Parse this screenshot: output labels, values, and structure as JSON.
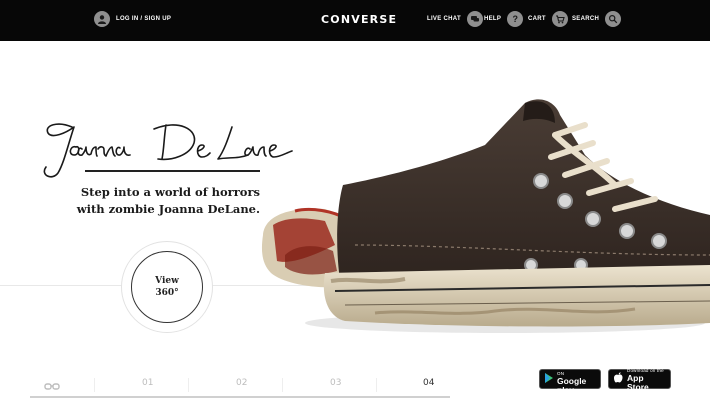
{
  "header": {
    "login_label": "LOG IN / SIGN UP",
    "logo_text": "CONVERSE",
    "live_chat_label": "LIVE CHAT",
    "help_label": "HELP",
    "cart_label": "CART",
    "search_label": "SEARCH",
    "icons": [
      "user-icon",
      "chat-icon",
      "help-icon",
      "cart-icon",
      "search-icon"
    ]
  },
  "hero": {
    "signature": "Joanna DeLane",
    "tagline_line1": "Step into a world of horrors",
    "tagline_line2": "with zombie Joanna DeLane.",
    "view_label": "View",
    "view_degrees": "360°"
  },
  "pager": {
    "icon": "glasses-icon",
    "pages": [
      "01",
      "02",
      "03",
      "04"
    ],
    "active_page": "04"
  },
  "stores": {
    "google_small": "ANDROID APP ON",
    "google_big": "Google play",
    "apple_small": "Download on the",
    "apple_big": "App Store"
  },
  "colors": {
    "topbar": "#070707",
    "icon_circle": "#8f8f8f",
    "shoe_canvas": "#3b2f28",
    "blood": "#9a2a1e"
  }
}
